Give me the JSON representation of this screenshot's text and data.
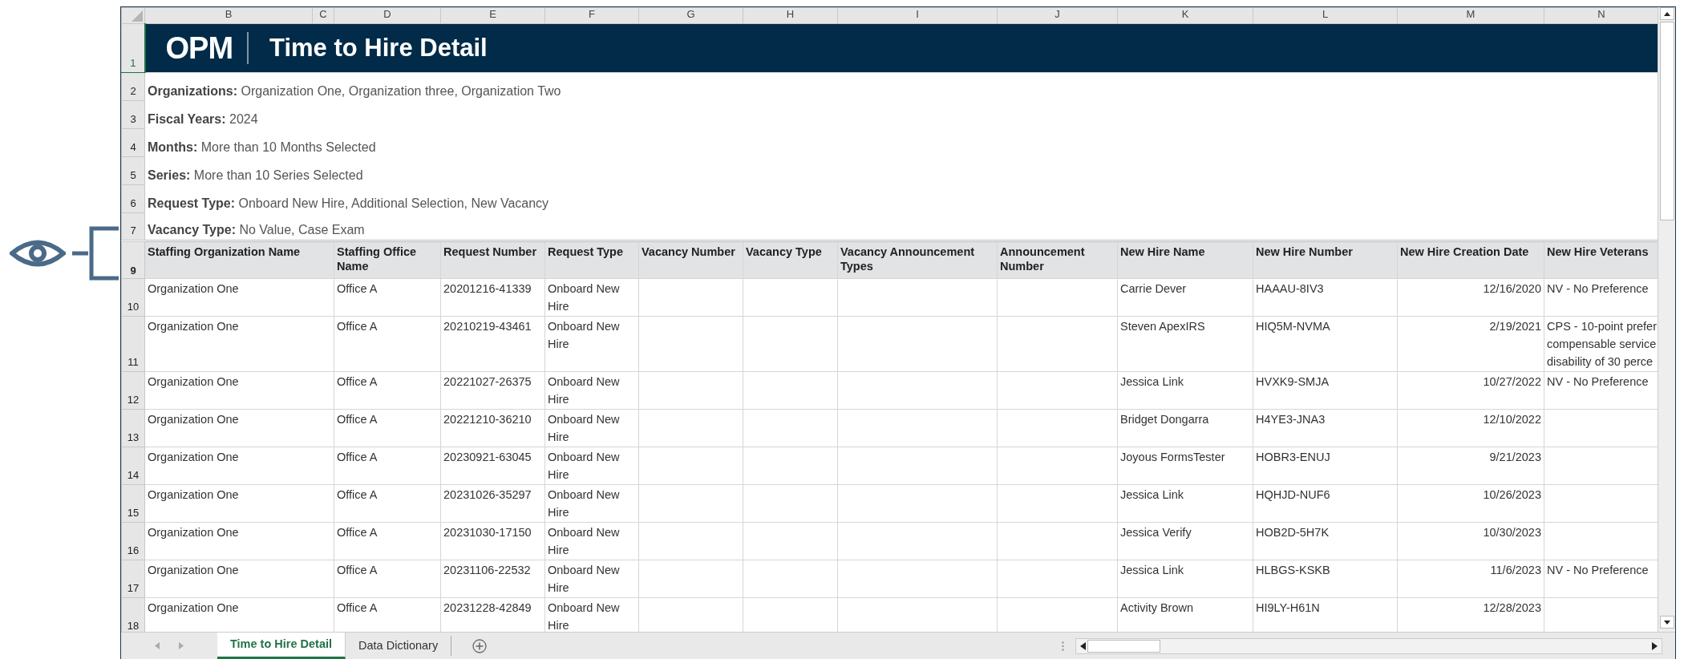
{
  "column_letters": [
    "B",
    "C",
    "D",
    "E",
    "F",
    "G",
    "H",
    "I",
    "J",
    "K",
    "L",
    "M",
    "N"
  ],
  "banner": {
    "row": "1",
    "selected": true,
    "logo": "OPM",
    "title": "Time to Hire Detail"
  },
  "filters": [
    {
      "row": "2",
      "selected": false,
      "text": "**Organizations:** Organization One, Organization three, Organization Two"
    },
    {
      "row": "3",
      "selected": false,
      "text": "**Fiscal Years:** 2024"
    },
    {
      "row": "4",
      "selected": false,
      "text": "**Months:** More than 10 Months Selected"
    },
    {
      "row": "5",
      "selected": false,
      "text": "**Series:** More than 10 Series Selected"
    },
    {
      "row": "6",
      "selected": false,
      "text": "**Request Type:** Onboard New Hire, Additional Selection, New Vacancy"
    },
    {
      "row": "7",
      "selected": false,
      "text": "**Vacancy Type:** No Value, Case Exam"
    }
  ],
  "header_row": {
    "row": "9",
    "selected": false,
    "columns": [
      "Staffing Organization Name",
      "Staffing Office Name",
      "Request Number",
      "Request Type",
      "Vacancy Number",
      "Vacancy Type",
      "Vacancy Announcement Types",
      "Announcement Number",
      "New Hire Name",
      "New Hire Number",
      "New Hire Creation Date",
      "New Hire Veterans"
    ]
  },
  "rows": [
    {
      "row": "10",
      "selected": false,
      "cells": [
        "Organization One",
        "Office A",
        "20201216-41339",
        "Onboard New Hire",
        null,
        null,
        null,
        null,
        "Carrie Dever",
        "HAAAU-8IV3",
        "12/16/2020",
        "NV - No Preference"
      ]
    },
    {
      "row": "11",
      "selected": false,
      "cells": [
        "Organization One",
        "Office A",
        "20210219-43461",
        "Onboard New Hire",
        null,
        null,
        null,
        null,
        "Steven ApexIRS",
        "HIQ5M-NVMA",
        "2/19/2021",
        "CPS - 10-point prefer\ncompensable service\ndisability of 30 perce"
      ]
    },
    {
      "row": "12",
      "selected": false,
      "cells": [
        "Organization One",
        "Office A",
        "20221027-26375",
        "Onboard New Hire",
        null,
        null,
        null,
        null,
        "Jessica Link",
        "HVXK9-SMJA",
        "10/27/2022",
        "NV - No Preference"
      ]
    },
    {
      "row": "13",
      "selected": false,
      "cells": [
        "Organization One",
        "Office A",
        "20221210-36210",
        "Onboard New Hire",
        null,
        null,
        null,
        null,
        "Bridget Dongarra",
        "H4YE3-JNA3",
        "12/10/2022",
        null
      ]
    },
    {
      "row": "14",
      "selected": false,
      "cells": [
        "Organization One",
        "Office A",
        "20230921-63045",
        "Onboard New Hire",
        null,
        null,
        null,
        null,
        "Joyous FormsTester",
        "HOBR3-ENUJ",
        "9/21/2023",
        null
      ]
    },
    {
      "row": "15",
      "selected": false,
      "cells": [
        "Organization One",
        "Office A",
        "20231026-35297",
        "Onboard New Hire",
        null,
        null,
        null,
        null,
        "Jessica Link",
        "HQHJD-NUF6",
        "10/26/2023",
        null
      ]
    },
    {
      "row": "16",
      "selected": false,
      "cells": [
        "Organization One",
        "Office A",
        "20231030-17150",
        "Onboard New Hire",
        null,
        null,
        null,
        null,
        "Jessica Verify",
        "HOB2D-5H7K",
        "10/30/2023",
        null
      ]
    },
    {
      "row": "17",
      "selected": false,
      "cells": [
        "Organization One",
        "Office A",
        "20231106-22532",
        "Onboard New Hire",
        null,
        null,
        null,
        null,
        "Jessica Link",
        "HLBGS-KSKB",
        "11/6/2023",
        "NV - No Preference"
      ]
    },
    {
      "row": "18",
      "selected": false,
      "cells": [
        "Organization One",
        "Office A",
        "20231228-42849",
        "Onboard New Hire",
        null,
        null,
        null,
        null,
        "Activity Brown",
        "HI9LY-H61N",
        "12/28/2023",
        null
      ]
    }
  ],
  "sheet_tabs": [
    {
      "label": "Time to Hire Detail",
      "selected": true
    },
    {
      "label": "Data Dictionary",
      "selected": false
    }
  ]
}
